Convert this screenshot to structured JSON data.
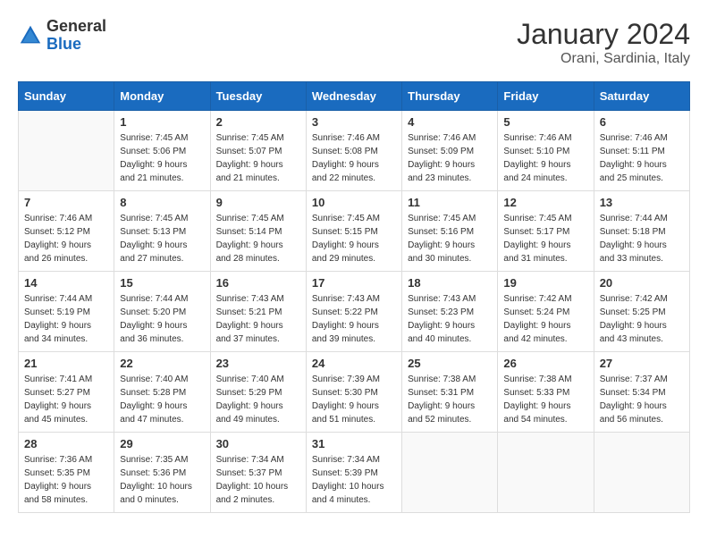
{
  "logo": {
    "general": "General",
    "blue": "Blue"
  },
  "title": "January 2024",
  "location": "Orani, Sardinia, Italy",
  "days_of_week": [
    "Sunday",
    "Monday",
    "Tuesday",
    "Wednesday",
    "Thursday",
    "Friday",
    "Saturday"
  ],
  "weeks": [
    [
      {
        "day": "",
        "sunrise": "",
        "sunset": "",
        "daylight": ""
      },
      {
        "day": "1",
        "sunrise": "Sunrise: 7:45 AM",
        "sunset": "Sunset: 5:06 PM",
        "daylight": "Daylight: 9 hours and 21 minutes."
      },
      {
        "day": "2",
        "sunrise": "Sunrise: 7:45 AM",
        "sunset": "Sunset: 5:07 PM",
        "daylight": "Daylight: 9 hours and 21 minutes."
      },
      {
        "day": "3",
        "sunrise": "Sunrise: 7:46 AM",
        "sunset": "Sunset: 5:08 PM",
        "daylight": "Daylight: 9 hours and 22 minutes."
      },
      {
        "day": "4",
        "sunrise": "Sunrise: 7:46 AM",
        "sunset": "Sunset: 5:09 PM",
        "daylight": "Daylight: 9 hours and 23 minutes."
      },
      {
        "day": "5",
        "sunrise": "Sunrise: 7:46 AM",
        "sunset": "Sunset: 5:10 PM",
        "daylight": "Daylight: 9 hours and 24 minutes."
      },
      {
        "day": "6",
        "sunrise": "Sunrise: 7:46 AM",
        "sunset": "Sunset: 5:11 PM",
        "daylight": "Daylight: 9 hours and 25 minutes."
      }
    ],
    [
      {
        "day": "7",
        "sunrise": "Sunrise: 7:46 AM",
        "sunset": "Sunset: 5:12 PM",
        "daylight": "Daylight: 9 hours and 26 minutes."
      },
      {
        "day": "8",
        "sunrise": "Sunrise: 7:45 AM",
        "sunset": "Sunset: 5:13 PM",
        "daylight": "Daylight: 9 hours and 27 minutes."
      },
      {
        "day": "9",
        "sunrise": "Sunrise: 7:45 AM",
        "sunset": "Sunset: 5:14 PM",
        "daylight": "Daylight: 9 hours and 28 minutes."
      },
      {
        "day": "10",
        "sunrise": "Sunrise: 7:45 AM",
        "sunset": "Sunset: 5:15 PM",
        "daylight": "Daylight: 9 hours and 29 minutes."
      },
      {
        "day": "11",
        "sunrise": "Sunrise: 7:45 AM",
        "sunset": "Sunset: 5:16 PM",
        "daylight": "Daylight: 9 hours and 30 minutes."
      },
      {
        "day": "12",
        "sunrise": "Sunrise: 7:45 AM",
        "sunset": "Sunset: 5:17 PM",
        "daylight": "Daylight: 9 hours and 31 minutes."
      },
      {
        "day": "13",
        "sunrise": "Sunrise: 7:44 AM",
        "sunset": "Sunset: 5:18 PM",
        "daylight": "Daylight: 9 hours and 33 minutes."
      }
    ],
    [
      {
        "day": "14",
        "sunrise": "Sunrise: 7:44 AM",
        "sunset": "Sunset: 5:19 PM",
        "daylight": "Daylight: 9 hours and 34 minutes."
      },
      {
        "day": "15",
        "sunrise": "Sunrise: 7:44 AM",
        "sunset": "Sunset: 5:20 PM",
        "daylight": "Daylight: 9 hours and 36 minutes."
      },
      {
        "day": "16",
        "sunrise": "Sunrise: 7:43 AM",
        "sunset": "Sunset: 5:21 PM",
        "daylight": "Daylight: 9 hours and 37 minutes."
      },
      {
        "day": "17",
        "sunrise": "Sunrise: 7:43 AM",
        "sunset": "Sunset: 5:22 PM",
        "daylight": "Daylight: 9 hours and 39 minutes."
      },
      {
        "day": "18",
        "sunrise": "Sunrise: 7:43 AM",
        "sunset": "Sunset: 5:23 PM",
        "daylight": "Daylight: 9 hours and 40 minutes."
      },
      {
        "day": "19",
        "sunrise": "Sunrise: 7:42 AM",
        "sunset": "Sunset: 5:24 PM",
        "daylight": "Daylight: 9 hours and 42 minutes."
      },
      {
        "day": "20",
        "sunrise": "Sunrise: 7:42 AM",
        "sunset": "Sunset: 5:25 PM",
        "daylight": "Daylight: 9 hours and 43 minutes."
      }
    ],
    [
      {
        "day": "21",
        "sunrise": "Sunrise: 7:41 AM",
        "sunset": "Sunset: 5:27 PM",
        "daylight": "Daylight: 9 hours and 45 minutes."
      },
      {
        "day": "22",
        "sunrise": "Sunrise: 7:40 AM",
        "sunset": "Sunset: 5:28 PM",
        "daylight": "Daylight: 9 hours and 47 minutes."
      },
      {
        "day": "23",
        "sunrise": "Sunrise: 7:40 AM",
        "sunset": "Sunset: 5:29 PM",
        "daylight": "Daylight: 9 hours and 49 minutes."
      },
      {
        "day": "24",
        "sunrise": "Sunrise: 7:39 AM",
        "sunset": "Sunset: 5:30 PM",
        "daylight": "Daylight: 9 hours and 51 minutes."
      },
      {
        "day": "25",
        "sunrise": "Sunrise: 7:38 AM",
        "sunset": "Sunset: 5:31 PM",
        "daylight": "Daylight: 9 hours and 52 minutes."
      },
      {
        "day": "26",
        "sunrise": "Sunrise: 7:38 AM",
        "sunset": "Sunset: 5:33 PM",
        "daylight": "Daylight: 9 hours and 54 minutes."
      },
      {
        "day": "27",
        "sunrise": "Sunrise: 7:37 AM",
        "sunset": "Sunset: 5:34 PM",
        "daylight": "Daylight: 9 hours and 56 minutes."
      }
    ],
    [
      {
        "day": "28",
        "sunrise": "Sunrise: 7:36 AM",
        "sunset": "Sunset: 5:35 PM",
        "daylight": "Daylight: 9 hours and 58 minutes."
      },
      {
        "day": "29",
        "sunrise": "Sunrise: 7:35 AM",
        "sunset": "Sunset: 5:36 PM",
        "daylight": "Daylight: 10 hours and 0 minutes."
      },
      {
        "day": "30",
        "sunrise": "Sunrise: 7:34 AM",
        "sunset": "Sunset: 5:37 PM",
        "daylight": "Daylight: 10 hours and 2 minutes."
      },
      {
        "day": "31",
        "sunrise": "Sunrise: 7:34 AM",
        "sunset": "Sunset: 5:39 PM",
        "daylight": "Daylight: 10 hours and 4 minutes."
      },
      {
        "day": "",
        "sunrise": "",
        "sunset": "",
        "daylight": ""
      },
      {
        "day": "",
        "sunrise": "",
        "sunset": "",
        "daylight": ""
      },
      {
        "day": "",
        "sunrise": "",
        "sunset": "",
        "daylight": ""
      }
    ]
  ]
}
